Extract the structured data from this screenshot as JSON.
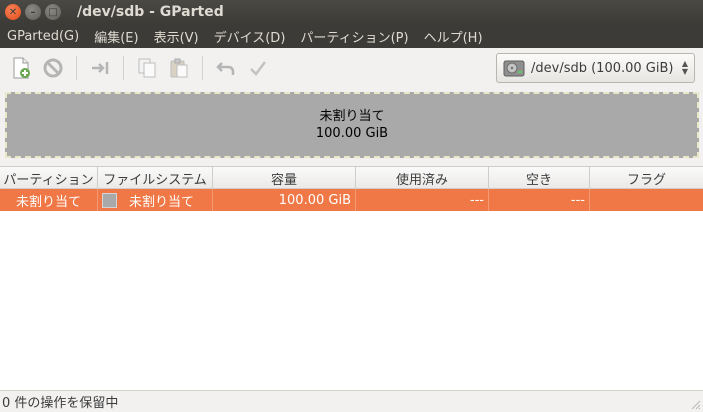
{
  "window": {
    "title": "/dev/sdb - GParted"
  },
  "menubar": {
    "items": [
      "GParted(G)",
      "編集(E)",
      "表示(V)",
      "デバイス(D)",
      "パーティション(P)",
      "ヘルプ(H)"
    ]
  },
  "device": {
    "label": "/dev/sdb   (100.00 GiB)"
  },
  "graph": {
    "name": "未割り当て",
    "size": "100.00 GiB",
    "fill_color": "#a9a9a9"
  },
  "table": {
    "columns": [
      "パーティション",
      "ファイルシステム",
      "容量",
      "使用済み",
      "空き",
      "フラグ"
    ],
    "rows": [
      {
        "partition": "未割り当て",
        "filesystem": "未割り当て",
        "size": "100.00 GiB",
        "used": "---",
        "unused": "---",
        "flags": ""
      }
    ],
    "selected_color": "#f07746"
  },
  "status": {
    "text": "0 件の操作を保留中"
  }
}
